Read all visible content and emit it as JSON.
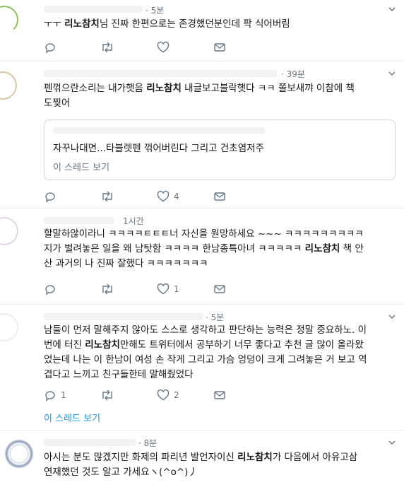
{
  "tweets": [
    {
      "time": "· 5분",
      "text_pre": "ㅜㅜ ",
      "mention": "리노참치",
      "text_post": "님 진짜 한편으로는 존경했던분인데 팍 식어버림",
      "reply_count": "",
      "like_count": ""
    },
    {
      "time": "· 39분",
      "line1_pre": "펜꺾으란소리는 내가햇음 ",
      "mention": "리노참치",
      "line1_post": " 내글보고블락햇다 ㅋㅋ 쫄보새꺄 이참에 책",
      "line2": "도찢어",
      "quote_text": "자꾸나대면...타블렛펜 꺾어버린다 그리고 건초염저주",
      "quote_thread": "이 스레드 보기",
      "like_count": "4"
    },
    {
      "time": "1시간",
      "line1": "할말하않이라니 ㅋㅋㅋㅋㅌㅌㅌ너 자신을 원망하세요 ~~~ ㅋㅋㅋㅋㅋㅋㅋㅋㅋ",
      "line2": "지가 벌려놓은 일을 왜 남탓함 ㅋㅋㅋㅋ 한남종특아녀 ㅋㅋㅋㅋㅋ ",
      "mention": "리노참치",
      "line2_post": " 책 안",
      "line3": "산 과거의 나 진짜 잘했다 ㅋㅋㅋㅋㅋㅋㅋ",
      "like_count": "1"
    },
    {
      "time": "· 5분",
      "line1": "남들이 먼저 말해주지 않아도 스스로 생각하고 판단하는 능력은 정말 중요하노. 이",
      "line2_pre": "번에 터진 ",
      "mention": "리노참치",
      "line2_post": "만해도 트위터에서 공부하기 너무 좋다고 추천 글 많이 올라왔",
      "line3": "었는데 나는 이 한남이 여성 손 작게 그리고 가슴 엉덩이 크게 그려놓은 거 보고 역",
      "line4": "겹다고 느끼고 친구들한테 말해줬었다",
      "reply_count": "1",
      "like_count": "2",
      "thread": "이 스레드 보기"
    },
    {
      "time": "· 8분",
      "line1_pre": "아시는 분도 많겠지만 화제의 파리년 발언자이신 ",
      "mention": "리노참치",
      "line1_post": "가 다음에서 아유고삼",
      "line2": "연재했던 것도 알고 가세요ヽ(^o^)丿"
    }
  ],
  "icons": [
    "reply-icon",
    "retweet-icon",
    "like-icon",
    "dm-icon",
    "chevron-down-icon"
  ],
  "colors": {
    "text": "#14171a",
    "muted": "#657786",
    "link": "#1b95e0",
    "border": "#e6ecf0"
  }
}
